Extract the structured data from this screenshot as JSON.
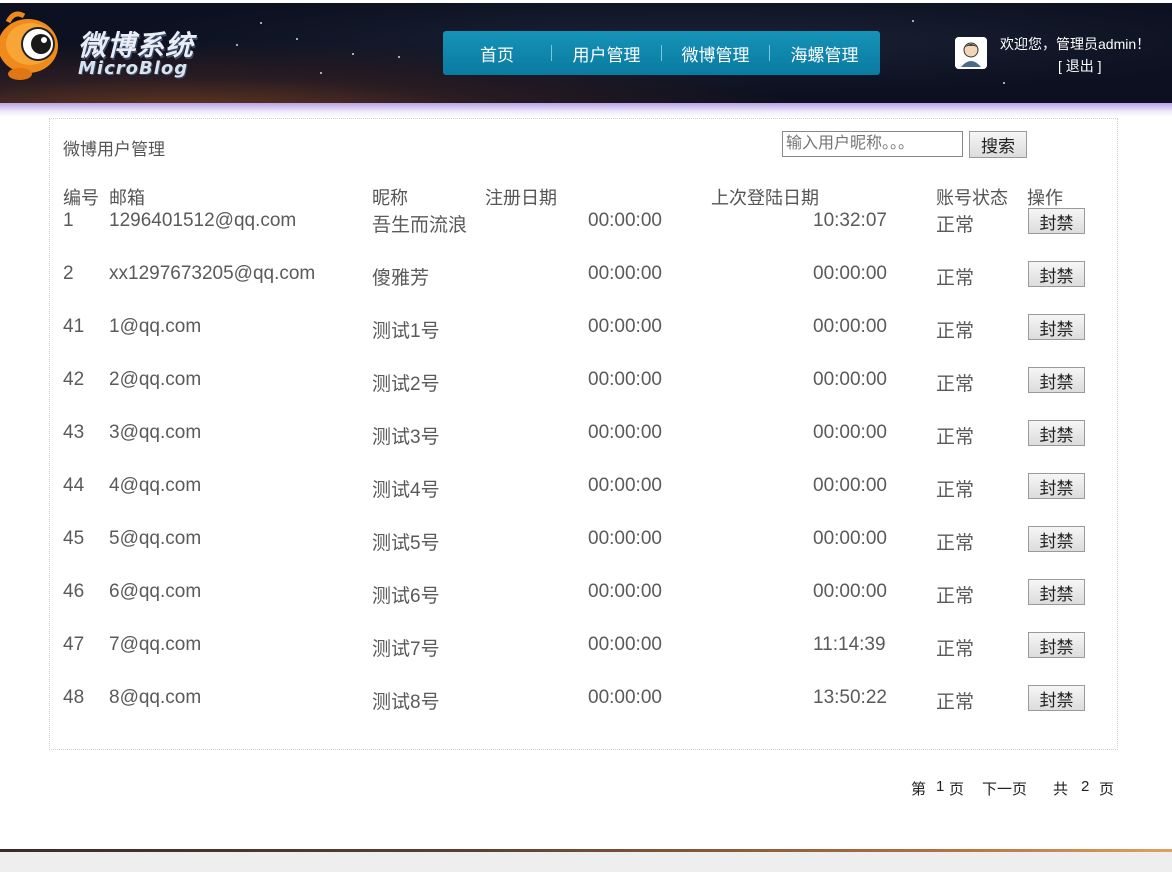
{
  "brand": {
    "title": "微博系统",
    "subtitle": "MicroBlog"
  },
  "nav": [
    "首页",
    "用户管理",
    "微博管理",
    "海螺管理"
  ],
  "user": {
    "welcome": "欢迎您，管理员admin！",
    "logout": "[ 退出 ]"
  },
  "panel": {
    "title": "微博用户管理",
    "search_placeholder": "输入用户昵称。。。",
    "search_button": "搜索"
  },
  "columns": [
    "编号",
    "邮箱",
    "昵称",
    "注册日期",
    "上次登陆日期",
    "账号状态",
    "操作"
  ],
  "rows": [
    {
      "id": "1",
      "email": "1296401512@qq.com",
      "nickname": "吾生而流浪",
      "reg": "00:00:00",
      "last": "10:32:07",
      "status": "正常",
      "action": "封禁"
    },
    {
      "id": "2",
      "email": "xx1297673205@qq.com",
      "nickname": "傻雅芳",
      "reg": "00:00:00",
      "last": "00:00:00",
      "status": "正常",
      "action": "封禁"
    },
    {
      "id": "41",
      "email": "1@qq.com",
      "nickname": "测试1号",
      "reg": "00:00:00",
      "last": "00:00:00",
      "status": "正常",
      "action": "封禁"
    },
    {
      "id": "42",
      "email": "2@qq.com",
      "nickname": "测试2号",
      "reg": "00:00:00",
      "last": "00:00:00",
      "status": "正常",
      "action": "封禁"
    },
    {
      "id": "43",
      "email": "3@qq.com",
      "nickname": "测试3号",
      "reg": "00:00:00",
      "last": "00:00:00",
      "status": "正常",
      "action": "封禁"
    },
    {
      "id": "44",
      "email": "4@qq.com",
      "nickname": "测试4号",
      "reg": "00:00:00",
      "last": "00:00:00",
      "status": "正常",
      "action": "封禁"
    },
    {
      "id": "45",
      "email": "5@qq.com",
      "nickname": "测试5号",
      "reg": "00:00:00",
      "last": "00:00:00",
      "status": "正常",
      "action": "封禁"
    },
    {
      "id": "46",
      "email": "6@qq.com",
      "nickname": "测试6号",
      "reg": "00:00:00",
      "last": "00:00:00",
      "status": "正常",
      "action": "封禁"
    },
    {
      "id": "47",
      "email": "7@qq.com",
      "nickname": "测试7号",
      "reg": "00:00:00",
      "last": "11:14:39",
      "status": "正常",
      "action": "封禁"
    },
    {
      "id": "48",
      "email": "8@qq.com",
      "nickname": "测试8号",
      "reg": "00:00:00",
      "last": "13:50:22",
      "status": "正常",
      "action": "封禁"
    }
  ],
  "pager": {
    "page_prefix": "第",
    "current": "1",
    "page_suffix": "页",
    "next": "下一页",
    "total_prefix": "共",
    "total": "2",
    "total_suffix": "页"
  },
  "icons": {
    "logo": "fish-eye-mascot-icon",
    "avatar": "user-avatar-icon"
  }
}
